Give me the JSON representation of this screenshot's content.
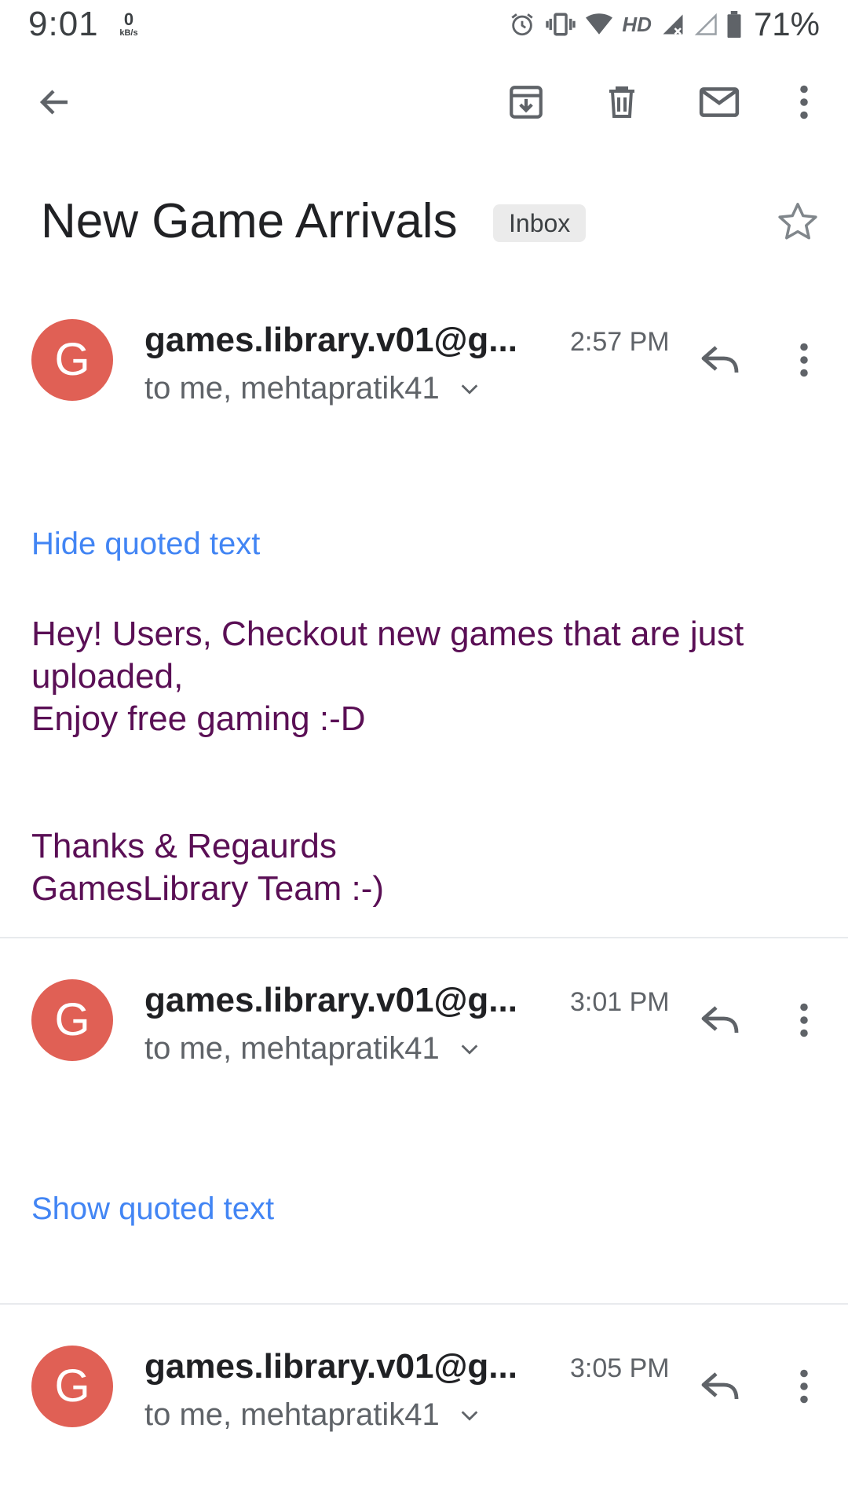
{
  "status_bar": {
    "time": "9:01",
    "net_speed_value": "0",
    "net_speed_unit": "kB/s",
    "network_label": "HD",
    "battery_percent": "71%",
    "icons": [
      "alarm-icon",
      "vibrate-icon",
      "wifi-icon",
      "signal-icon",
      "signal-empty-icon",
      "battery-icon"
    ]
  },
  "appbar": {
    "icons": [
      "back-arrow-icon",
      "archive-icon",
      "trash-icon",
      "mail-icon",
      "more-vert-icon"
    ]
  },
  "email": {
    "subject": "New Game Arrivals",
    "label": "Inbox",
    "star_icon": "star-outline-icon"
  },
  "messages": [
    {
      "avatar_letter": "G",
      "sender": "games.library.v01@g...",
      "time": "2:57 PM",
      "recipients": "to me, mehtapratik41",
      "quoted_toggle": "Hide quoted text",
      "body": [
        "Hey! Users, Checkout new games that are just uploaded,",
        "Enjoy free gaming :-D",
        "",
        "",
        "Thanks & Regaurds",
        "GamesLibrary Team :-)"
      ]
    },
    {
      "avatar_letter": "G",
      "sender": "games.library.v01@g...",
      "time": "3:01 PM",
      "recipients": "to me, mehtapratik41",
      "quoted_toggle": "Show quoted text"
    },
    {
      "avatar_letter": "G",
      "sender": "games.library.v01@g...",
      "time": "3:05 PM",
      "recipients": "to me, mehtapratik41"
    }
  ],
  "colors": {
    "avatar": "#e06055",
    "link": "#4285f4",
    "body_text": "#5a0f55",
    "icon": "#5f6368"
  }
}
